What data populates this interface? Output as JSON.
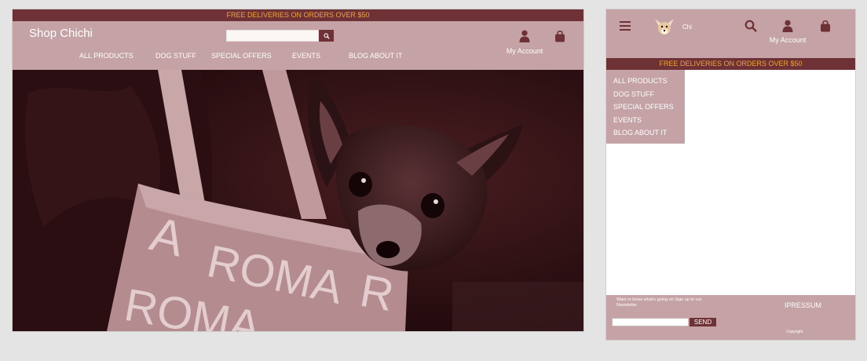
{
  "desktop": {
    "banner": "FREE DELIVERIES ON ORDERS OVER $50",
    "logo": "Shop Chichi",
    "search": {
      "placeholder": "",
      "value": ""
    },
    "account_label": "My Account",
    "nav": [
      "ALL PRODUCTS",
      "DOG STUFF",
      "SPECIAL OFFERS",
      "EVENTS",
      "BLOG ABOUT IT"
    ],
    "hero_text": [
      "A",
      "ROMA",
      "ROMA",
      "R"
    ]
  },
  "mobile": {
    "logo_text": "Chi",
    "account_label": "My Account",
    "banner": "FREE DELIVERIES ON ORDERS OVER $50",
    "menu": [
      "ALL PRODUCTS",
      "DOG STUFF",
      "SPECIAL OFFERS",
      "EVENTS",
      "BLOG ABOUT IT"
    ],
    "newsletter_text": "Want to know what's going on Sign up to our Newsletter",
    "send_label": "SEND",
    "impressum": "IPRESSUM",
    "copyright": "Copyright"
  },
  "colors": {
    "brand_dark": "#6e3236",
    "brand_light": "#c4a2a5",
    "banner_text": "#f0a536"
  },
  "icons": [
    "search-icon",
    "user-icon",
    "shopping-bag-icon",
    "hamburger-menu-icon",
    "dog-logo-icon"
  ]
}
